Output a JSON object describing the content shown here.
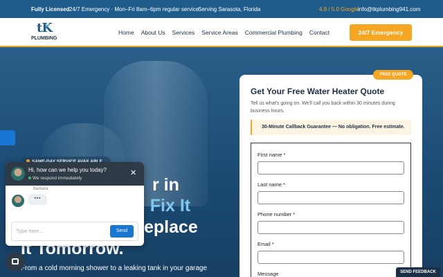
{
  "topbar": {
    "licensed": "Fully Licensed",
    "hours": "24/7 Emergency · Mon–Fri 8am–6pm regular service",
    "area": "Serving Sarasota, Florida",
    "rating": "4.9 / 5.0 Google",
    "email": "info@tkplumbing941.com"
  },
  "logo": {
    "mark": "tK",
    "word": "PLUMBING"
  },
  "nav": {
    "items": [
      "Home",
      "About Us",
      "Services",
      "Service Areas",
      "Commercial Plumbing",
      "Contact"
    ],
    "cta": "24/7 Emergency"
  },
  "hero": {
    "badge": "SAME-DAY SERVICE AVAILABLE",
    "headline": [
      "r in",
      "'ll Fix It",
      "eplace",
      "It Tomorrow."
    ],
    "subtext": "From a cold morning shower to a leaking tank in your garage"
  },
  "quote": {
    "badge": "FREE QUOTE",
    "title": "Get Your Free Water Heater Quote",
    "subtitle": "Tell us what's going on. We'll call you back within 30 minutes during business hours.",
    "guarantee": "30-Minute Callback Guarantee — No obligation. Free estimate.",
    "fields": [
      "First name *",
      "Last name *",
      "Phone number *",
      "Email *",
      "Message"
    ]
  },
  "chat": {
    "title": "Hi, how can we help you today?",
    "status": "We respond immediately",
    "agent": "Barbara",
    "typing": "•••",
    "placeholder": "Type here...",
    "send": "Send"
  },
  "feedback": "SEND FEEDBACK",
  "colors": {
    "primary": "#1f5c8c",
    "accent": "#f5a623",
    "navy": "#1b2f45",
    "link": "#1976d2"
  }
}
